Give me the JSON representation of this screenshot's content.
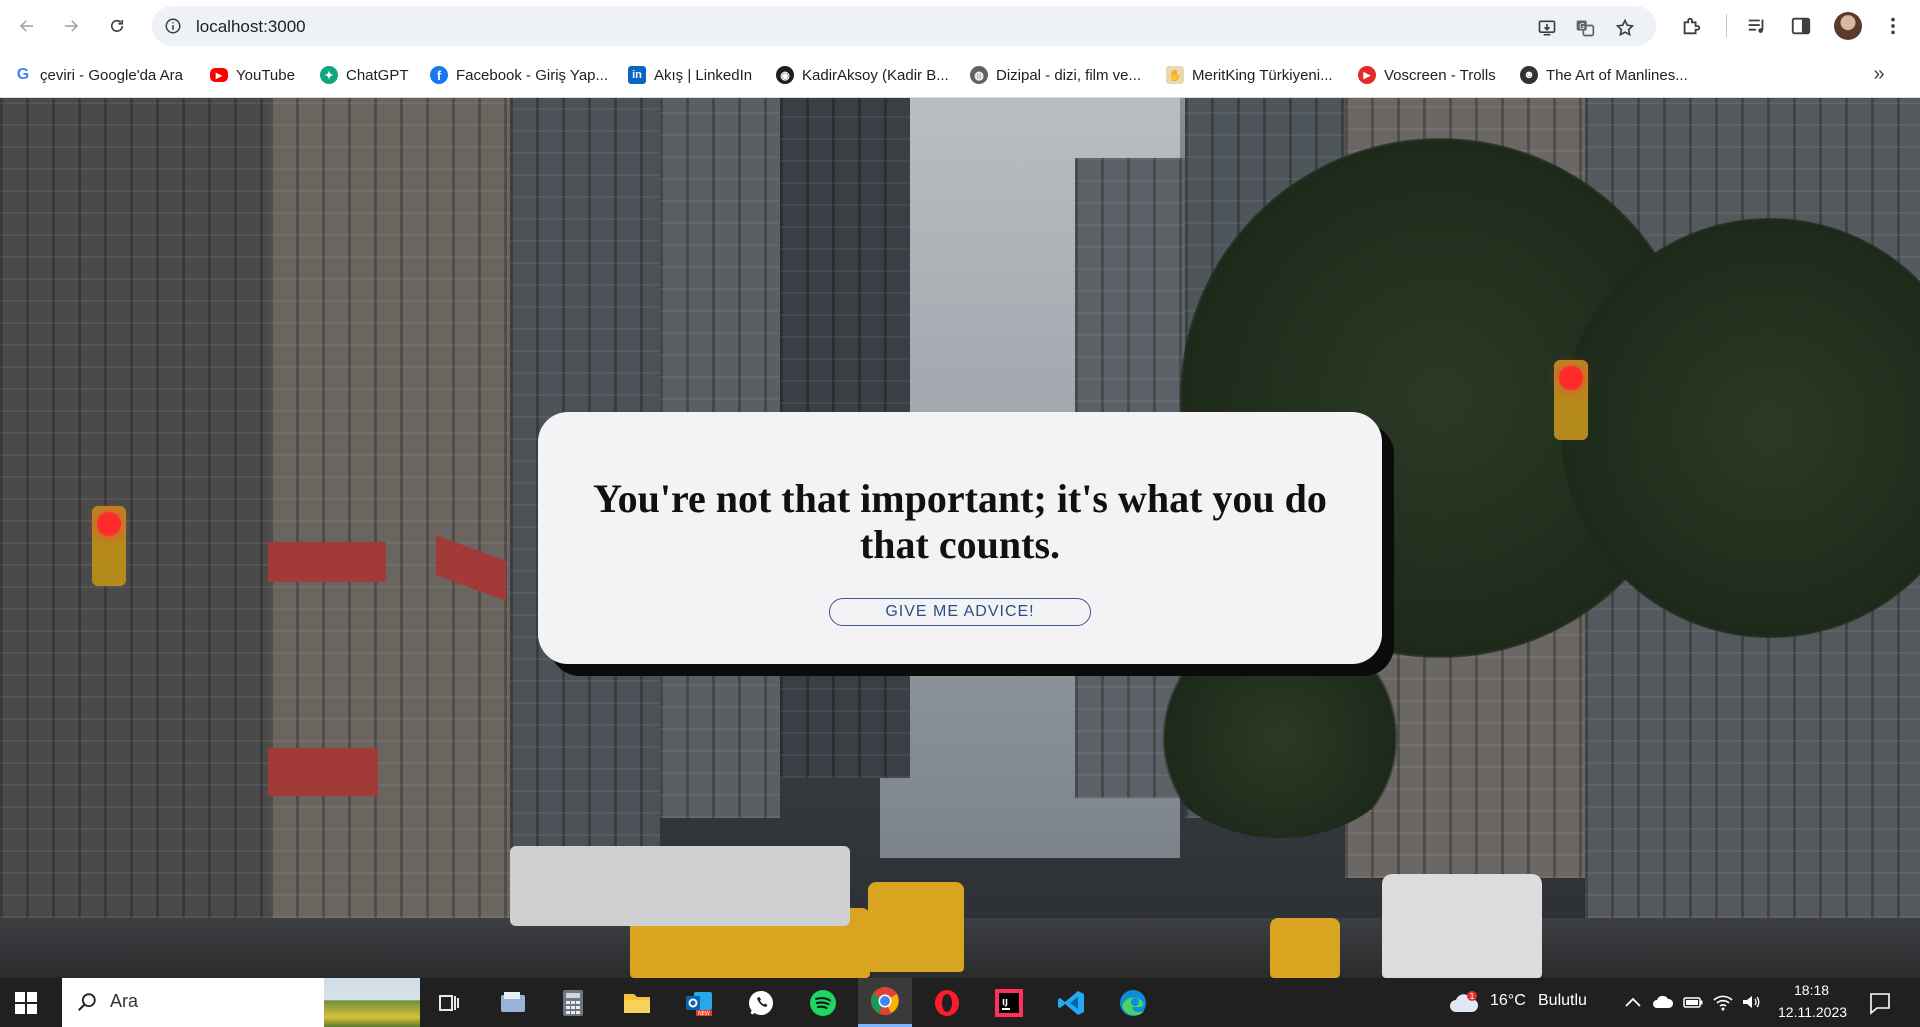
{
  "browser": {
    "url": "localhost:3000",
    "bookmarks": [
      {
        "label": "çeviri - Google'da Ara",
        "icon": "google-icon"
      },
      {
        "label": "YouTube",
        "icon": "youtube-icon"
      },
      {
        "label": "ChatGPT",
        "icon": "chatgpt-icon"
      },
      {
        "label": "Facebook - Giriş Yap...",
        "icon": "facebook-icon"
      },
      {
        "label": "Akış | LinkedIn",
        "icon": "linkedin-icon"
      },
      {
        "label": "KadirAksoy (Kadir B...",
        "icon": "github-icon"
      },
      {
        "label": "Dizipal - dizi, film ve...",
        "icon": "globe-icon"
      },
      {
        "label": "MeritKing Türkiyeni...",
        "icon": "meritking-icon"
      },
      {
        "label": "Voscreen - Trolls",
        "icon": "voscreen-icon"
      },
      {
        "label": "The Art of Manlines...",
        "icon": "manliness-icon"
      }
    ]
  },
  "page": {
    "quote": "You're not that important; it's what you do that counts.",
    "button_label": "GIVE ME ADVICE!"
  },
  "taskbar": {
    "search_placeholder": "Ara",
    "weather_temp": "16°C",
    "weather_desc": "Bulutlu",
    "weather_badge": "1",
    "time": "18:18",
    "date": "12.11.2023",
    "apps": [
      "task-view-icon",
      "file-explorer-icon",
      "calculator-icon",
      "folder-icon",
      "outlook-icon",
      "whatsapp-icon",
      "spotify-icon",
      "chrome-icon",
      "opera-icon",
      "intellij-icon",
      "vscode-icon",
      "edge-icon"
    ]
  },
  "colors": {
    "card_bg": "#f3f3f5",
    "button_text": "#2e4f84",
    "taskbar_bg": "#202020"
  }
}
